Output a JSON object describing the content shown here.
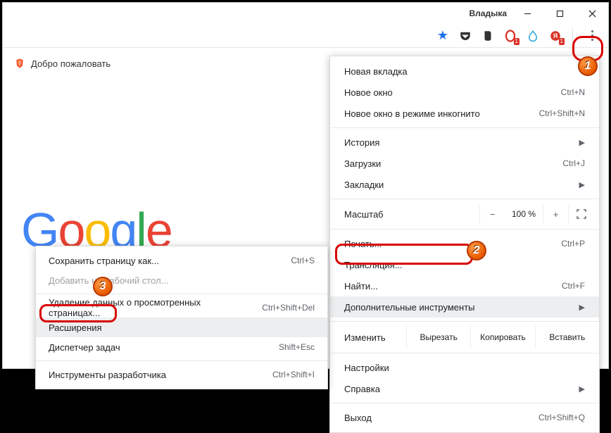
{
  "window": {
    "profile": "Владыка"
  },
  "content": {
    "welcome": "Добро пожаловать",
    "logo_letters": [
      "G",
      "o",
      "o",
      "g",
      "l",
      "e"
    ]
  },
  "toolbar": {
    "star": "★",
    "ext_badges": {
      "opera": "1",
      "yandex": "1"
    }
  },
  "menu": {
    "new_tab": "Новая вкладка",
    "new_window": "Новое окно",
    "new_window_sc": "Ctrl+N",
    "incognito": "Новое окно в режиме инкогнито",
    "incognito_sc": "Ctrl+Shift+N",
    "history": "История",
    "downloads": "Загрузки",
    "downloads_sc": "Ctrl+J",
    "bookmarks": "Закладки",
    "zoom_label": "Масштаб",
    "zoom_value": "100 %",
    "print": "Печать...",
    "print_sc": "Ctrl+P",
    "cast": "Трансляция...",
    "find": "Найти...",
    "find_sc": "Ctrl+F",
    "more_tools": "Дополнительные инструменты",
    "edit_label": "Изменить",
    "cut": "Вырезать",
    "copy": "Копировать",
    "paste": "Вставить",
    "settings": "Настройки",
    "help": "Справка",
    "exit": "Выход",
    "exit_sc": "Ctrl+Shift+Q"
  },
  "submenu": {
    "save_as": "Сохранить страницу как...",
    "save_as_sc": "Ctrl+S",
    "add_desktop": "Добавить на рабочий стол...",
    "clear_data": "Удаление данных о просмотренных страницах...",
    "clear_data_sc": "Ctrl+Shift+Del",
    "extensions": "Расширения",
    "task_manager": "Диспетчер задач",
    "task_manager_sc": "Shift+Esc",
    "dev_tools": "Инструменты разработчика",
    "dev_tools_sc": "Ctrl+Shift+I"
  },
  "callouts": {
    "n1": "1",
    "n2": "2",
    "n3": "3"
  }
}
